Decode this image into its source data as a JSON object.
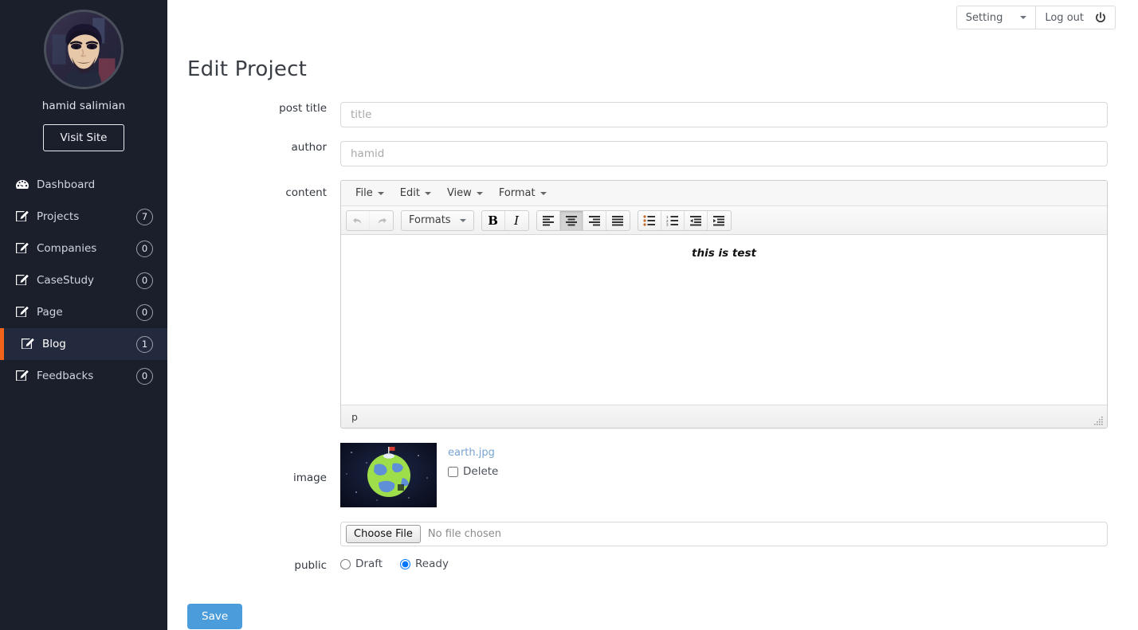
{
  "sidebar": {
    "user_name": "hamid salimian",
    "avatar_alt": "user-avatar",
    "visit_site_label": "Visit Site",
    "items": [
      {
        "label": "Dashboard",
        "badge": "",
        "icon": "dashboard-icon",
        "active": false
      },
      {
        "label": "Projects",
        "badge": "7",
        "icon": "edit-square-icon",
        "active": false
      },
      {
        "label": "Companies",
        "badge": "0",
        "icon": "edit-square-icon",
        "active": false
      },
      {
        "label": "CaseStudy",
        "badge": "0",
        "icon": "edit-square-icon",
        "active": false
      },
      {
        "label": "Page",
        "badge": "0",
        "icon": "edit-square-icon",
        "active": false
      },
      {
        "label": "Blog",
        "badge": "1",
        "icon": "edit-square-icon",
        "active": true
      },
      {
        "label": "Feedbacks",
        "badge": "0",
        "icon": "edit-square-icon",
        "active": false
      }
    ],
    "colors": {
      "background": "#1b1f2b",
      "active_background": "#232a3d",
      "active_accent": "#f2641a"
    }
  },
  "topbar": {
    "setting_label": "Setting",
    "logout_label": "Log out"
  },
  "page": {
    "title": "Edit Project"
  },
  "form": {
    "post_title": {
      "label": "post title",
      "value": "",
      "placeholder": "title"
    },
    "author": {
      "label": "author",
      "value": "",
      "placeholder": "hamid"
    },
    "content": {
      "label": "content"
    },
    "image": {
      "label": "image"
    },
    "public": {
      "label": "public"
    }
  },
  "editor": {
    "menubar": [
      "File",
      "Edit",
      "View",
      "Format"
    ],
    "formats_label": "Formats",
    "buttons": [
      {
        "name": "undo-icon",
        "state": "disabled"
      },
      {
        "name": "redo-icon",
        "state": "disabled"
      },
      {
        "name": "bold-icon",
        "state": "normal",
        "glyph": "B"
      },
      {
        "name": "italic-icon",
        "state": "normal",
        "glyph": "I"
      },
      {
        "name": "align-left-icon",
        "state": "normal"
      },
      {
        "name": "align-center-icon",
        "state": "active"
      },
      {
        "name": "align-right-icon",
        "state": "normal"
      },
      {
        "name": "align-justify-icon",
        "state": "normal"
      },
      {
        "name": "bullet-list-icon",
        "state": "normal"
      },
      {
        "name": "numbered-list-icon",
        "state": "normal"
      },
      {
        "name": "outdent-icon",
        "state": "normal"
      },
      {
        "name": "indent-icon",
        "state": "normal"
      }
    ],
    "content_text": "this is test",
    "status_path": "p"
  },
  "upload": {
    "file_name": "earth.jpg",
    "delete_label": "Delete",
    "delete_checked": false,
    "choose_file_label": "Choose File",
    "no_file_text": "No file chosen"
  },
  "public_options": [
    {
      "label": "Draft",
      "selected": false
    },
    {
      "label": "Ready",
      "selected": true
    }
  ],
  "actions": {
    "save_label": "Save",
    "save_color": "#4b9cdb"
  }
}
